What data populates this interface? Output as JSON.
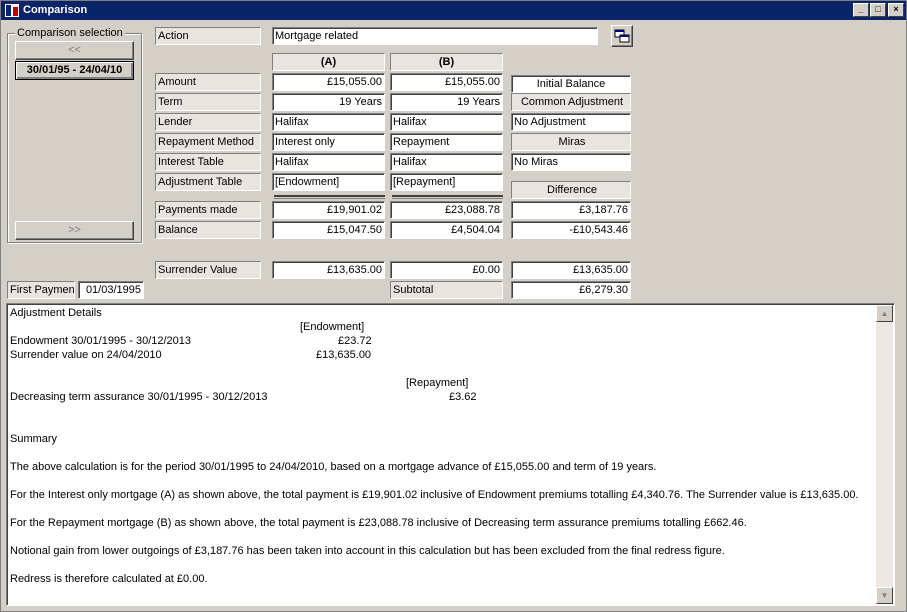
{
  "window": {
    "title": "Comparison"
  },
  "selection": {
    "group_label": "Comparison selection",
    "prev_label": "<<",
    "current_label": "30/01/95 - 24/04/10",
    "next_label": ">>"
  },
  "action": {
    "label": "Action",
    "value": "Mortgage related"
  },
  "columns": {
    "a": "(A)",
    "b": "(B)"
  },
  "rows": {
    "amount": {
      "label": "Amount",
      "a": "£15,055.00",
      "b": "£15,055.00"
    },
    "term": {
      "label": "Term",
      "a": "19 Years",
      "b": "19 Years"
    },
    "lender": {
      "label": "Lender",
      "a": "Halifax",
      "b": "Halifax"
    },
    "repayment": {
      "label": "Repayment Method",
      "a": "Interest only",
      "b": "Repayment"
    },
    "interest": {
      "label": "Interest Table",
      "a": "Halifax",
      "b": "Halifax"
    },
    "adjustment": {
      "label": "Adjustment Table",
      "a": "[Endowment]",
      "b": "[Repayment]"
    },
    "payments": {
      "label": "Payments made",
      "a": "£19,901.02",
      "b": "£23,088.78",
      "diff": "£3,187.76"
    },
    "balance": {
      "label": "Balance",
      "a": "£15,047.50",
      "b": "£4,504.04",
      "diff": "-£10,543.46"
    },
    "surrender": {
      "label": "Surrender Value",
      "a": "£13,635.00",
      "b": "£0.00",
      "diff": "£13,635.00"
    }
  },
  "right_panel": {
    "initial_balance": "Initial Balance",
    "common_adjustment_label": "Common Adjustment",
    "common_adjustment_value": "No Adjustment",
    "miras_label": "Miras",
    "miras_value": "No Miras",
    "difference_label": "Difference"
  },
  "first_payment": {
    "label": "First Payment",
    "value": "01/03/1995"
  },
  "subtotal": {
    "label": "Subtotal",
    "value": "£6,279.30"
  },
  "details": {
    "heading": "Adjustment Details",
    "endowment_header": "[Endowment]",
    "endowment_line1_label": "Endowment 30/01/1995 - 30/12/2013",
    "endowment_line1_value": "£23.72",
    "endowment_line2_label": "Surrender value on 24/04/2010",
    "endowment_line2_value": "£13,635.00",
    "repayment_header": "[Repayment]",
    "repayment_line_label": "Decreasing term assurance 30/01/1995 - 30/12/2013",
    "repayment_line_value": "£3.62",
    "summary_heading": "Summary",
    "p1": "The above calculation is for the period 30/01/1995 to 24/04/2010, based on a mortgage advance of £15,055.00 and term of 19 years.",
    "p2": "For the Interest only mortgage (A) as shown above, the total payment is £19,901.02 inclusive of Endowment premiums totalling £4,340.76. The Surrender value is £13,635.00.",
    "p3": "For the Repayment mortgage (B) as shown above, the total payment is £23,088.78 inclusive of Decreasing term assurance premiums totalling £662.46.",
    "p4": "Notional gain from lower outgoings of £3,187.76 has been taken into account in this calculation but has been excluded from the final redress figure.",
    "p5": "Redress is therefore calculated at £0.00."
  },
  "titlebar_buttons": {
    "minimize": "_",
    "maximize": "□",
    "close": "×"
  },
  "scroll": {
    "up": "▲",
    "down": "▼"
  }
}
